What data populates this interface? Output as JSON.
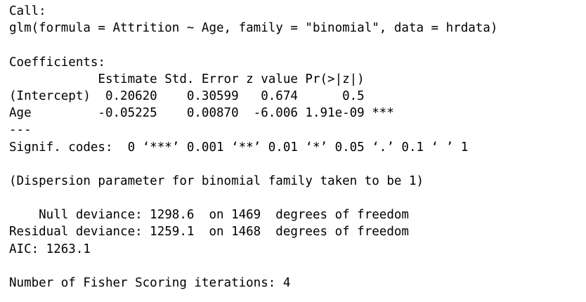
{
  "console": {
    "call_header": "Call:",
    "call_text": "glm(formula = Attrition ~ Age, family = \"binomial\", data = hrdata)",
    "coefficients_header": "Coefficients:",
    "coef_table_header": "            Estimate Std. Error z value Pr(>|z|)",
    "coef_rows": [
      "(Intercept)  0.20620    0.30599   0.674      0.5",
      "Age         -0.05225    0.00870  -6.006 1.91e-09 ***"
    ],
    "separator": "---",
    "signif_codes": "Signif. codes:  0 ‘***’ 0.001 ‘**’ 0.01 ‘*’ 0.05 ‘.’ 0.1 ‘ ’ 1",
    "dispersion": "(Dispersion parameter for binomial family taken to be 1)",
    "null_deviance": "    Null deviance: 1298.6  on 1469  degrees of freedom",
    "residual_deviance": "Residual deviance: 1259.1  on 1468  degrees of freedom",
    "aic": "AIC: 1263.1",
    "fisher_iterations": "Number of Fisher Scoring iterations: 4"
  }
}
